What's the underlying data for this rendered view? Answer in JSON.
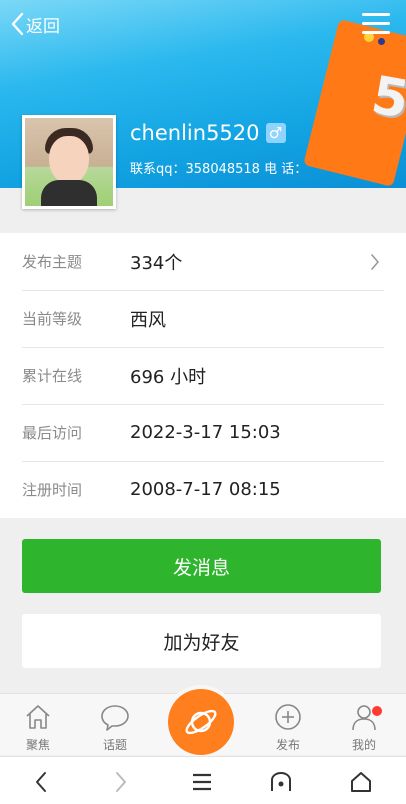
{
  "header": {
    "back_label": "返回",
    "deco_number": "5",
    "username": "chenlin5520",
    "gender_symbol": "♂",
    "contact": "联系qq：358048518  电 话："
  },
  "info": [
    {
      "label": "发布主题",
      "value": "334个",
      "has_arrow": true
    },
    {
      "label": "当前等级",
      "value": "西风"
    },
    {
      "label": "累计在线",
      "value": "696 小时"
    },
    {
      "label": "最后访问",
      "value": "2022-3-17 15:03"
    },
    {
      "label": "注册时间",
      "value": "2008-7-17 08:15"
    }
  ],
  "actions": {
    "send_message": "发消息",
    "add_friend": "加为好友"
  },
  "tabbar": {
    "home": "聚焦",
    "topics": "话题",
    "publish": "发布",
    "mine": "我的"
  },
  "colors": {
    "banner": "#12a3e2",
    "primary_button": "#2fb52d",
    "center_button": "#ff7f1e",
    "badge": "#ff3a30"
  }
}
